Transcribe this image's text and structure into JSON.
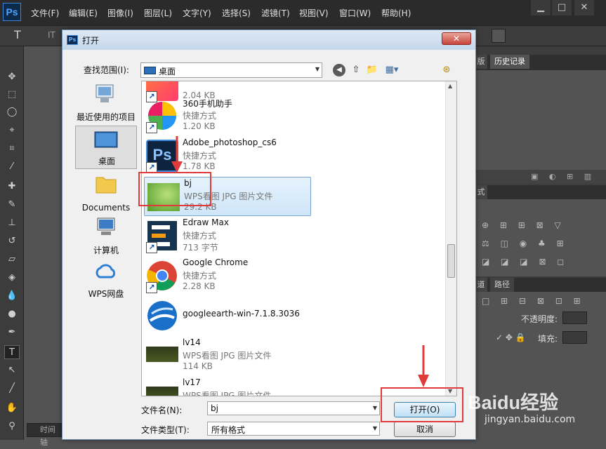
{
  "app": {
    "logo": "Ps",
    "menu": [
      "文件(F)",
      "编辑(E)",
      "图像(I)",
      "图层(L)",
      "文字(Y)",
      "选择(S)",
      "滤镜(T)",
      "视图(V)",
      "窗口(W)",
      "帮助(H)"
    ],
    "window_buttons": [
      "▁",
      "□",
      "✕"
    ],
    "option_tool_glyph": "T",
    "option_anchor_glyph": "IT"
  },
  "right_panels": {
    "tab_left": "版",
    "tab_history": "历史记录",
    "tab_styles": "式",
    "tab_paths_prefix": "道",
    "tab_paths": "路径",
    "opacity_label": "不透明度:",
    "fill_label": "填充:",
    "lock_glyphs": "✓ ✥ 🔒",
    "style_row1": "⊕ ⊞ ⊞ ⊠ ▽",
    "style_row2": "⚖ ◫ ◉ ♣ ⊞",
    "style_row3": "◪ ◪ ◪ ⊠ ◻",
    "paths_icons": "□ ⊞ ⊟ ⊠ ⊡ ⊞",
    "footer_icons": "▣ ◐ ⊞ ▥"
  },
  "timeline_label": "时间轴",
  "dialog": {
    "title": "打开",
    "close_glyph": "✕",
    "look_in_label": "查找范围(I):",
    "look_in_value": "桌面",
    "nav_buttons": [
      "◀",
      "⇧",
      "📁",
      "▦▾",
      "⊛"
    ],
    "places": [
      {
        "label": "最近使用的项目",
        "icon": "recent-items-icon"
      },
      {
        "label": "桌面",
        "icon": "desktop-icon"
      },
      {
        "label": "Documents",
        "icon": "folder-icon"
      },
      {
        "label": "计算机",
        "icon": "computer-icon"
      },
      {
        "label": "WPS网盘",
        "icon": "cloud-icon"
      }
    ],
    "files": [
      {
        "name": "",
        "type": "",
        "size": "2.04 KB",
        "icon": "app-icon",
        "shortcut": true
      },
      {
        "name": "360手机助手",
        "type": "快捷方式",
        "size": "1.20 KB",
        "icon": "360-icon",
        "shortcut": true
      },
      {
        "name": "Adobe_photoshop_cs6",
        "type": "快捷方式",
        "size": "1.78 KB",
        "icon": "photoshop-icon",
        "shortcut": true
      },
      {
        "name": "bj",
        "type": "WPS看图 JPG 图片文件",
        "size": "29.2 KB",
        "icon": "image-thumbnail-icon",
        "shortcut": false,
        "selected": true
      },
      {
        "name": "Edraw Max",
        "type": "快捷方式",
        "size": "713 字节",
        "icon": "edraw-icon",
        "shortcut": true
      },
      {
        "name": "Google Chrome",
        "type": "快捷方式",
        "size": "2.28 KB",
        "icon": "chrome-icon",
        "shortcut": true
      },
      {
        "name": "googleearth-win-7.1.8.3036",
        "type": "",
        "size": "",
        "icon": "google-earth-icon",
        "shortcut": false
      },
      {
        "name": "lv14",
        "type": "WPS看图 JPG 图片文件",
        "size": "114 KB",
        "icon": "game-thumbnail-icon",
        "shortcut": false
      },
      {
        "name": "lv17",
        "type": "WPS看图 JPG 图片文件",
        "size": "",
        "icon": "game-thumbnail-icon",
        "shortcut": false
      }
    ],
    "filename_label": "文件名(N):",
    "filename_value": "bj",
    "filetype_label": "文件类型(T):",
    "filetype_value": "所有格式",
    "open_button": "打开(O)",
    "cancel_button": "取消"
  },
  "watermark": {
    "logo_text": "Baidu经验",
    "url": "jingyan.baidu.com"
  },
  "colors": {
    "annotation_red": "#e03a3a",
    "selection_blue": "#cfe6f9",
    "ps_dark": "#2b2b2b"
  }
}
